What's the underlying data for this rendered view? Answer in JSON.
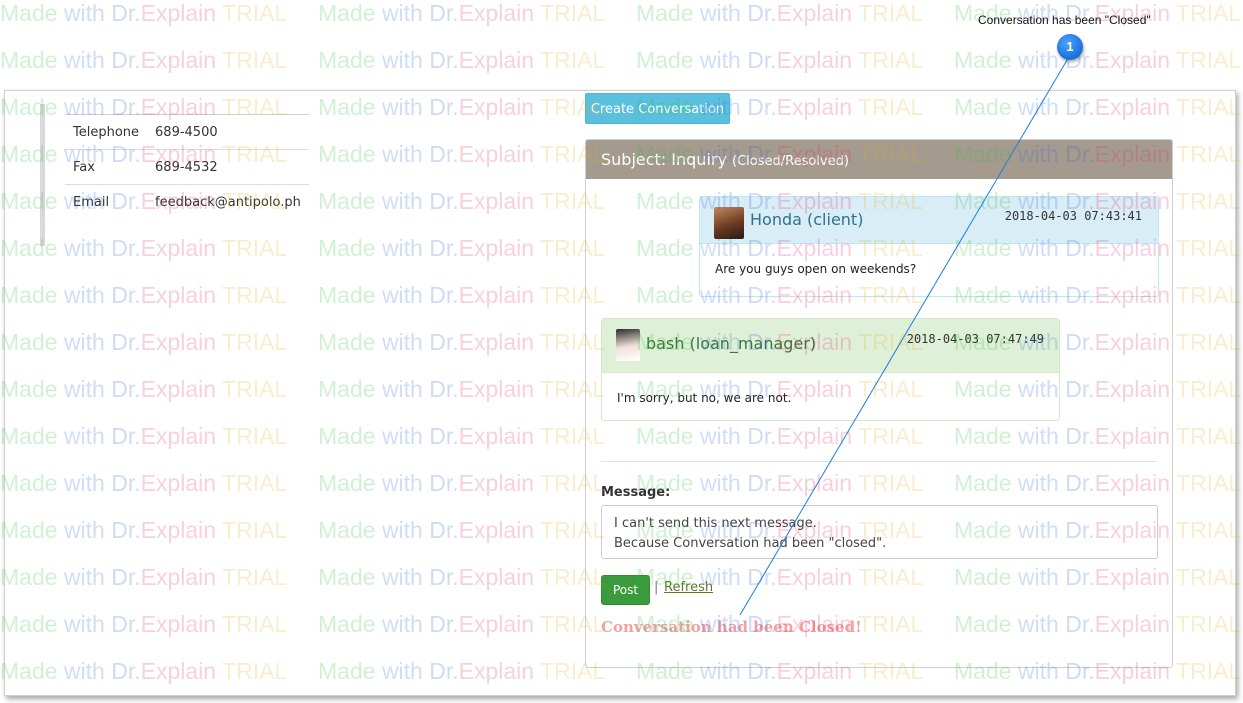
{
  "contact": {
    "rows": [
      {
        "label": "Telephone",
        "value": "689-4500"
      },
      {
        "label": "Fax",
        "value": "689-4532"
      },
      {
        "label": "Email",
        "value": "feedback@antipolo.ph"
      }
    ]
  },
  "create_button_label": "Create Conversation",
  "conversation": {
    "subject_prefix": "Subject: Inquiry",
    "status": "(Closed/Resolved)",
    "messages": [
      {
        "author": "Honda (client)",
        "time": "2018-04-03 07:43:41",
        "text": "Are you guys open on weekends?"
      },
      {
        "author": "bash (loan_manager)",
        "time": "2018-04-03 07:47:49",
        "text": "I'm sorry, but no, we are not."
      }
    ],
    "message_label": "Message:",
    "message_value": "I can't send this next message.\nBecause Conversation had been \"closed\".",
    "post_label": "Post",
    "separator": "|",
    "refresh_label": "Refresh",
    "closed_notice": "Conversation had been Closed!"
  },
  "callout": {
    "number": "1",
    "text": "Conversation has been \"Closed\""
  },
  "watermark": {
    "made": "Made",
    "with": "with",
    "dr": "Dr.",
    "explain": "Explain",
    "trial": "TRIAL"
  },
  "colors": {
    "panel_header": "#a59a8e",
    "client_bg": "#d9edf7",
    "manager_bg": "#dff0d8",
    "create_button": "#5bc0de",
    "post_button": "#3b9a3b",
    "closed_notice": "#f0a0a0",
    "callout": "#1a6fdc"
  }
}
